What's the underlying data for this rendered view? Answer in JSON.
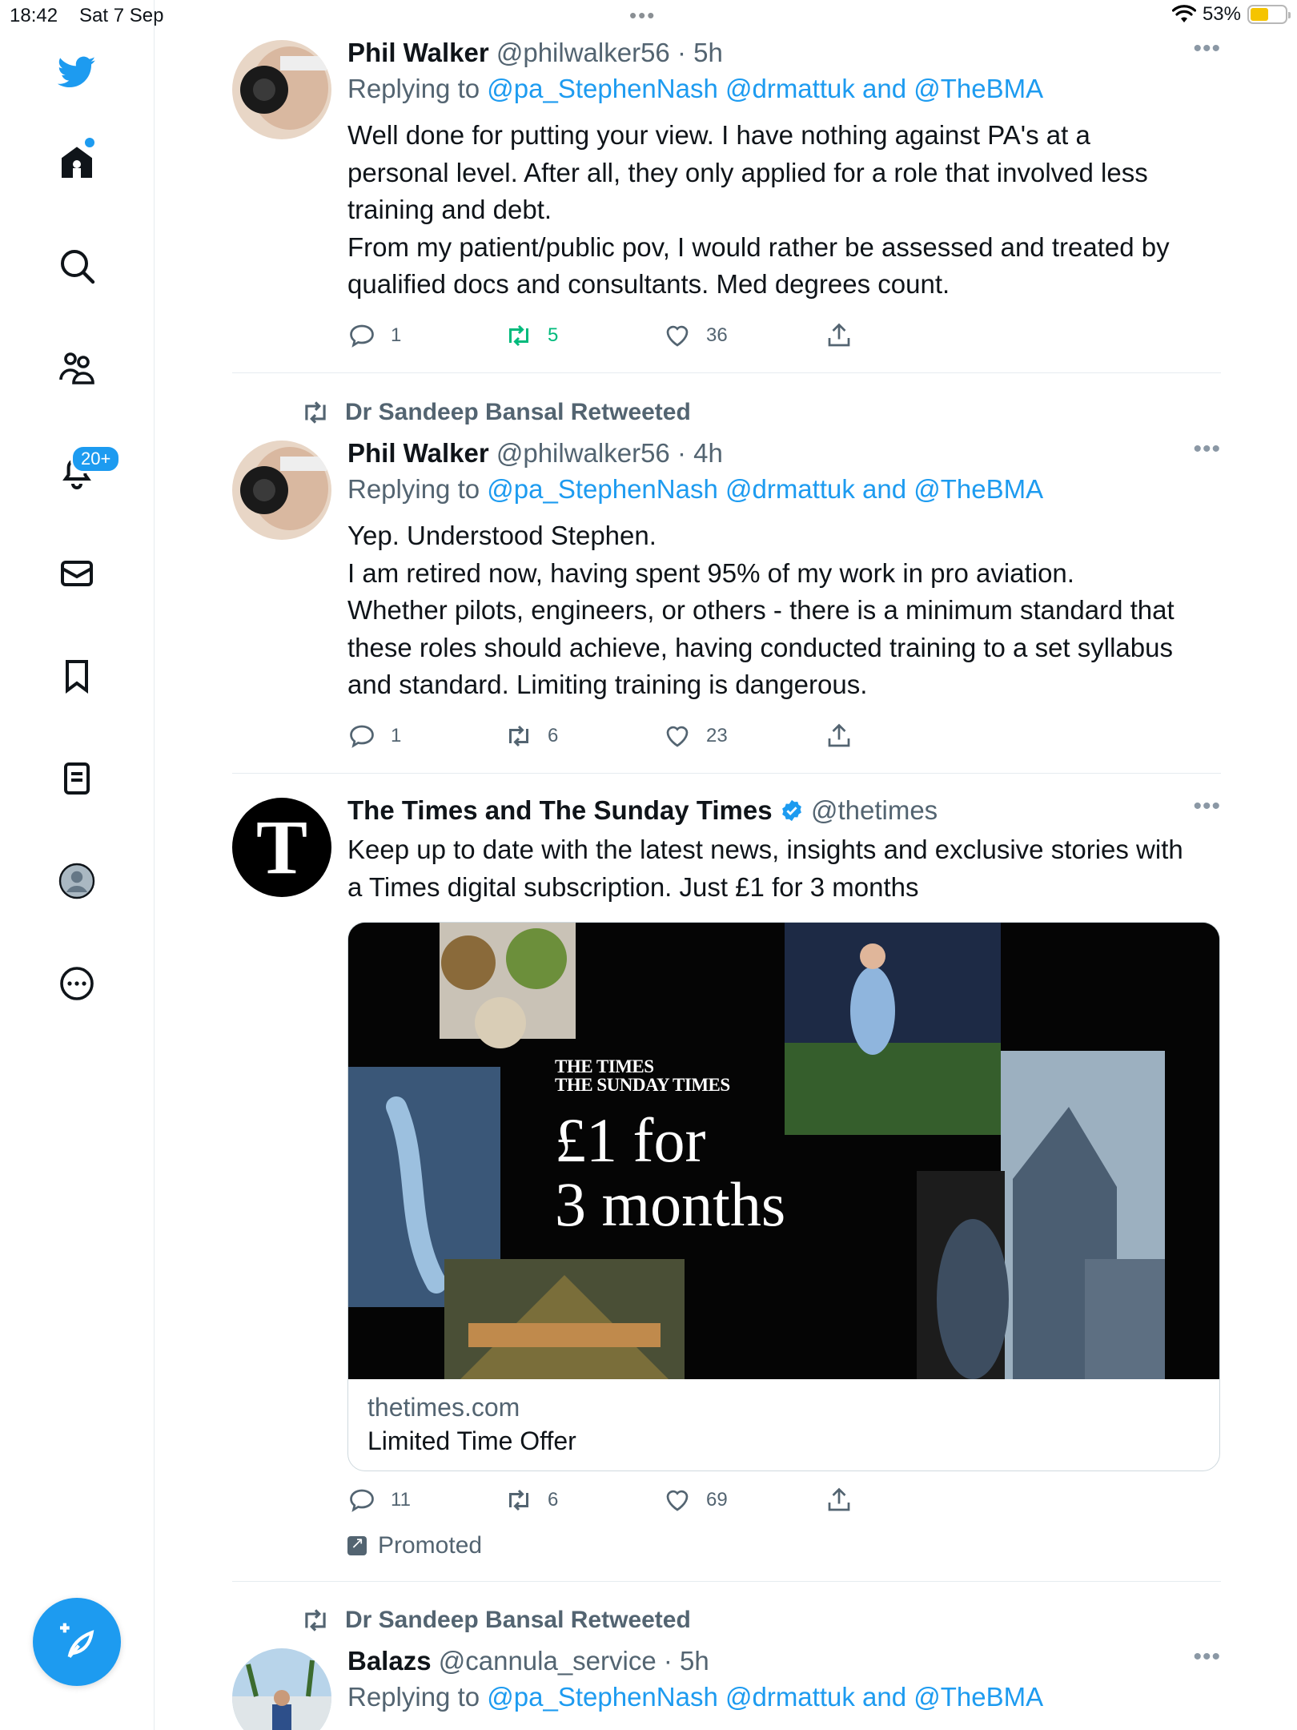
{
  "status_bar": {
    "time": "18:42",
    "date": "Sat 7 Sep",
    "battery_percent": "53%",
    "battery_level": 0.53
  },
  "sidebar": {
    "notifications_badge": "20+"
  },
  "feed": {
    "tweet1": {
      "name": "Phil Walker",
      "handle": "@philwalker56",
      "time": "· 5h",
      "replying_prefix": "Replying to ",
      "replying_targets": "@pa_StephenNash @drmattuk",
      "replying_and": " and ",
      "replying_last": "@TheBMA",
      "text": "Well done for putting your view. I have nothing against PA's at a\npersonal level. After all, they only applied for a role that involved less\ntraining and debt.\nFrom my patient/public pov, I would rather be assessed and treated by\nqualified docs and consultants. Med degrees count.",
      "replies": "1",
      "retweets": "5",
      "likes": "36"
    },
    "tweet2": {
      "retweeted_by": "Dr Sandeep Bansal Retweeted",
      "name": "Phil Walker",
      "handle": "@philwalker56",
      "time": "· 4h",
      "replying_prefix": "Replying to ",
      "replying_targets": "@pa_StephenNash @drmattuk",
      "replying_and": " and ",
      "replying_last": "@TheBMA",
      "text": "Yep. Understood Stephen.\nI am retired now, having spent 95% of my work in pro aviation.\nWhether pilots, engineers, or others - there is a minimum standard that\nthese roles should achieve, having conducted training to a set syllabus\nand standard. Limiting training is dangerous.",
      "replies": "1",
      "retweets": "6",
      "likes": "23"
    },
    "ad": {
      "name": "The Times and The Sunday Times",
      "handle": "@thetimes",
      "avatar_letter": "T",
      "text": "Keep up to date with the latest news, insights and exclusive stories with\na Times digital subscription. Just £1 for 3 months",
      "card_logo_line1": "THE  TIMES",
      "card_logo_line2": "THE SUNDAY TIMES",
      "card_offer_line1": "£1 for",
      "card_offer_line2": "3 months",
      "card_domain": "thetimes.com",
      "card_title": "Limited Time Offer",
      "replies": "11",
      "retweets": "6",
      "likes": "69",
      "promoted": "Promoted"
    },
    "tweet3": {
      "retweeted_by": "Dr Sandeep Bansal Retweeted",
      "name": "Balazs",
      "handle": "@cannula_service",
      "time": "· 5h",
      "replying_prefix": "Replying to ",
      "replying_targets": "@pa_StephenNash @drmattuk",
      "replying_and": " and ",
      "replying_last": "@TheBMA"
    }
  },
  "colors": {
    "accent": "#1d9bf0",
    "muted": "#536471",
    "retweet_active": "#00ba7c",
    "battery": "#f5c400"
  }
}
